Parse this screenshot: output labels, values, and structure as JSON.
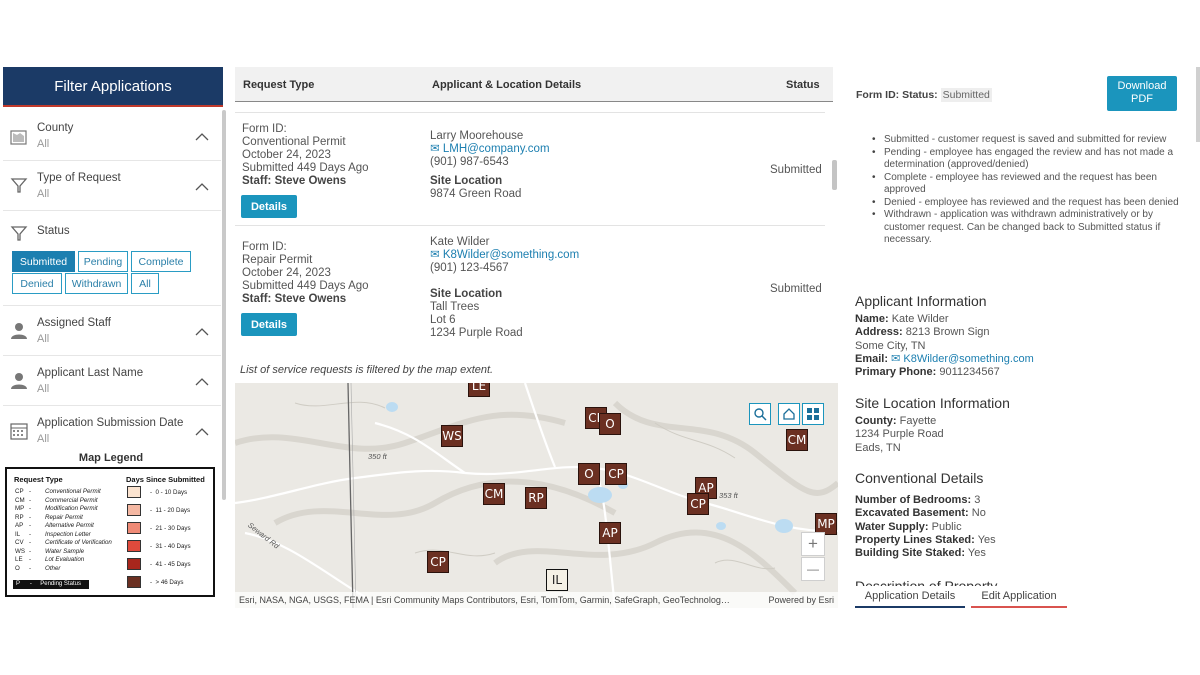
{
  "filter": {
    "title": "Filter Applications",
    "county": {
      "label": "County",
      "value": "All"
    },
    "type_of_request": {
      "label": "Type of Request",
      "value": "All"
    },
    "status": {
      "label": "Status",
      "buttons": [
        "Submitted",
        "Pending",
        "Complete",
        "Denied",
        "Withdrawn",
        "All"
      ],
      "active": "Submitted"
    },
    "assigned_staff": {
      "label": "Assigned Staff",
      "value": "All"
    },
    "applicant_last_name": {
      "label": "Applicant Last Name",
      "value": "All"
    },
    "submission_date": {
      "label": "Application Submission Date",
      "value": "All"
    }
  },
  "legend": {
    "title": "Map Legend",
    "request_type_header": "Request Type",
    "days_header": "Days Since Submitted",
    "types": [
      {
        "code": "CP",
        "name": "Conventional Permit"
      },
      {
        "code": "CM",
        "name": "Commercial Permit"
      },
      {
        "code": "MP",
        "name": "Modification Permit"
      },
      {
        "code": "RP",
        "name": "Repair Permit"
      },
      {
        "code": "AP",
        "name": "Alternative Permit"
      },
      {
        "code": "IL",
        "name": "Inspection Letter"
      },
      {
        "code": "CV",
        "name": "Certificate of Verification"
      },
      {
        "code": "WS",
        "name": "Water Sample"
      },
      {
        "code": "LE",
        "name": "Lot Evaluation"
      },
      {
        "code": "O",
        "name": "Other"
      }
    ],
    "pending": {
      "code": "P",
      "name": "Pending Status"
    },
    "days": [
      {
        "range": "0 - 10 Days",
        "color": "#fbe3cf"
      },
      {
        "range": "11 - 20 Days",
        "color": "#f5b8a3"
      },
      {
        "range": "21 - 30 Days",
        "color": "#ef8a76"
      },
      {
        "range": "31 - 40 Days",
        "color": "#e04a3c"
      },
      {
        "range": "41 - 45 Days",
        "color": "#a8261c"
      },
      {
        "range": "> 46 Days",
        "color": "#6b3022"
      }
    ]
  },
  "table": {
    "headers": {
      "request_type": "Request Type",
      "applicant": "Applicant & Location Details",
      "status": "Status"
    },
    "records": [
      {
        "form_id": "Form ID:",
        "permit": "Conventional Permit",
        "date": "October 24, 2023",
        "submitted": "Submitted 449 Days Ago",
        "staff": "Staff: Steve Owens",
        "details_label": "Details",
        "name": "Larry Moorehouse",
        "email": "LMH@company.com",
        "phone": "(901) 987-6543",
        "site_label": "Site Location",
        "site_lines": [
          "9874 Green Road"
        ],
        "status": "Submitted"
      },
      {
        "form_id": "Form ID:",
        "permit": "Repair Permit",
        "date": "October 24, 2023",
        "submitted": "Submitted 449 Days Ago",
        "staff": "Staff: Steve Owens",
        "details_label": "Details",
        "name": "Kate Wilder",
        "email": "K8Wilder@something.com",
        "phone": "(901) 123-4567",
        "site_label": "Site Location",
        "site_lines": [
          "Tall Trees",
          "Lot 6",
          "1234 Purple Road"
        ],
        "status": "Submitted"
      }
    ],
    "note": "List of service requests is filtered by the map extent."
  },
  "map": {
    "markers": [
      {
        "code": "LE"
      },
      {
        "code": "WS"
      },
      {
        "code": "CP"
      },
      {
        "code": "O"
      },
      {
        "code": "O"
      },
      {
        "code": "CP"
      },
      {
        "code": "CM"
      },
      {
        "code": "RP"
      },
      {
        "code": "AP"
      },
      {
        "code": "CP"
      },
      {
        "code": "AP"
      },
      {
        "code": "CP"
      },
      {
        "code": "IL"
      },
      {
        "code": "CM"
      },
      {
        "code": "MP"
      }
    ],
    "scale_labels": [
      "350 ft",
      "353 ft"
    ],
    "road_label": "Seward Rd",
    "attribution": "Esri, NASA, NGA, USGS, FEMA | Esri Community Maps Contributors, Esri, TomTom, Garmin, SafeGraph, GeoTechnolog…",
    "powered_by": "Powered by Esri",
    "zoom_in": "+",
    "zoom_out": "—"
  },
  "detail": {
    "form_id_label": "Form ID:",
    "status_label": "Status:",
    "status_value": "Submitted",
    "download_label_1": "Download",
    "download_label_2": "PDF",
    "status_notes": [
      "Submitted - customer request is saved and submitted for review",
      "Pending - employee has engaged the review and has not made a determination (approved/denied)",
      "Complete - employee has reviewed and the request has been approved",
      "Denied - employee has reviewed and the request has been denied",
      "Withdrawn - application was withdrawn administratively or by customer request. Can be changed back to Submitted status if necessary."
    ],
    "applicant": {
      "heading": "Applicant Information",
      "name_label": "Name:",
      "name": "Kate Wilder",
      "address_label": "Address:",
      "address_1": "8213 Brown Sign",
      "address_2": "Some City, TN",
      "email_label": "Email:",
      "email": "K8Wilder@something.com",
      "phone_label": "Primary Phone:",
      "phone": "9011234567"
    },
    "site": {
      "heading": "Site Location Information",
      "county_label": "County:",
      "county": "Fayette",
      "line_1": "1234 Purple Road",
      "line_2": "Eads, TN"
    },
    "conventional": {
      "heading": "Conventional Details",
      "bedrooms_label": "Number of Bedrooms:",
      "bedrooms": "3",
      "basement_label": "Excavated Basement:",
      "basement": "No",
      "water_label": "Water Supply:",
      "water": "Public",
      "lines_label": "Property Lines Staked:",
      "lines": "Yes",
      "building_label": "Building Site Staked:",
      "building": "Yes"
    },
    "next_heading": "Description of Property",
    "tabs": [
      "Application Details",
      "Edit Application"
    ]
  }
}
